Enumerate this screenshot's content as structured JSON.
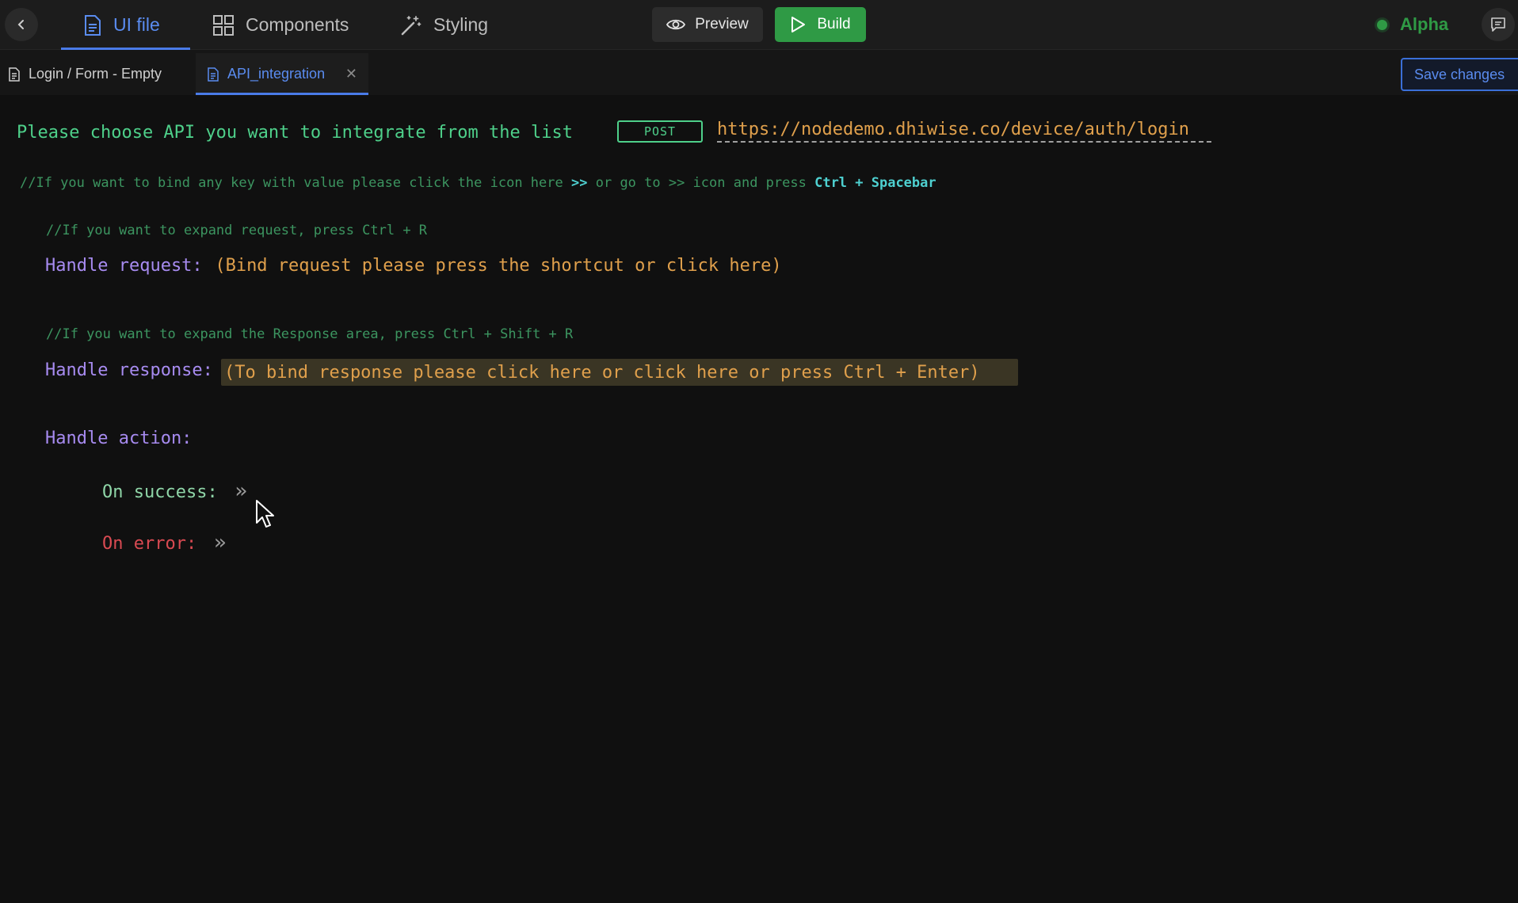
{
  "topbar": {
    "back_icon": "chevron-left-icon",
    "tabs": [
      {
        "label": "UI file",
        "icon": "file-icon",
        "active": true
      },
      {
        "label": "Components",
        "icon": "grid-icon",
        "active": false
      },
      {
        "label": "Styling",
        "icon": "magic-wand-icon",
        "active": false
      }
    ],
    "preview_label": "Preview",
    "build_label": "Build",
    "status_label": "Alpha",
    "chat_icon": "chat-icon"
  },
  "filetabs": {
    "items": [
      {
        "label": "Login / Form - Empty",
        "active": false
      },
      {
        "label": "API_integration",
        "active": true
      }
    ],
    "save_label": "Save changes"
  },
  "editor": {
    "api_prompt": "Please choose API you want to integrate from the list",
    "method": "POST",
    "url": "https://nodedemo.dhiwise.co/device/auth/login",
    "bind_hint_prefix": "//If you want to bind any key with value please click the icon here",
    "bind_hint_arrow": ">>",
    "bind_hint_middle": "or go to >> icon and press",
    "bind_hint_shortcut": "Ctrl + Spacebar",
    "request_comment": "//If you want to expand request, press Ctrl + R",
    "request_label": "Handle request:",
    "request_value": "(Bind request please press the shortcut or click here)",
    "response_comment": "//If you want to expand the Response area, press Ctrl + Shift + R",
    "response_label": "Handle response:",
    "response_value": "(To bind response please click here or click here or press Ctrl + Enter)",
    "action_label": "Handle action:",
    "success_label": "On success:",
    "error_label": "On error:",
    "chevron": "»"
  },
  "colors": {
    "accent_blue": "#4a7be8",
    "build_green": "#2f9a45",
    "code_green": "#4ed08a",
    "code_orange": "#e0a04c",
    "code_purple": "#a78bf0",
    "code_red": "#d94a52"
  }
}
